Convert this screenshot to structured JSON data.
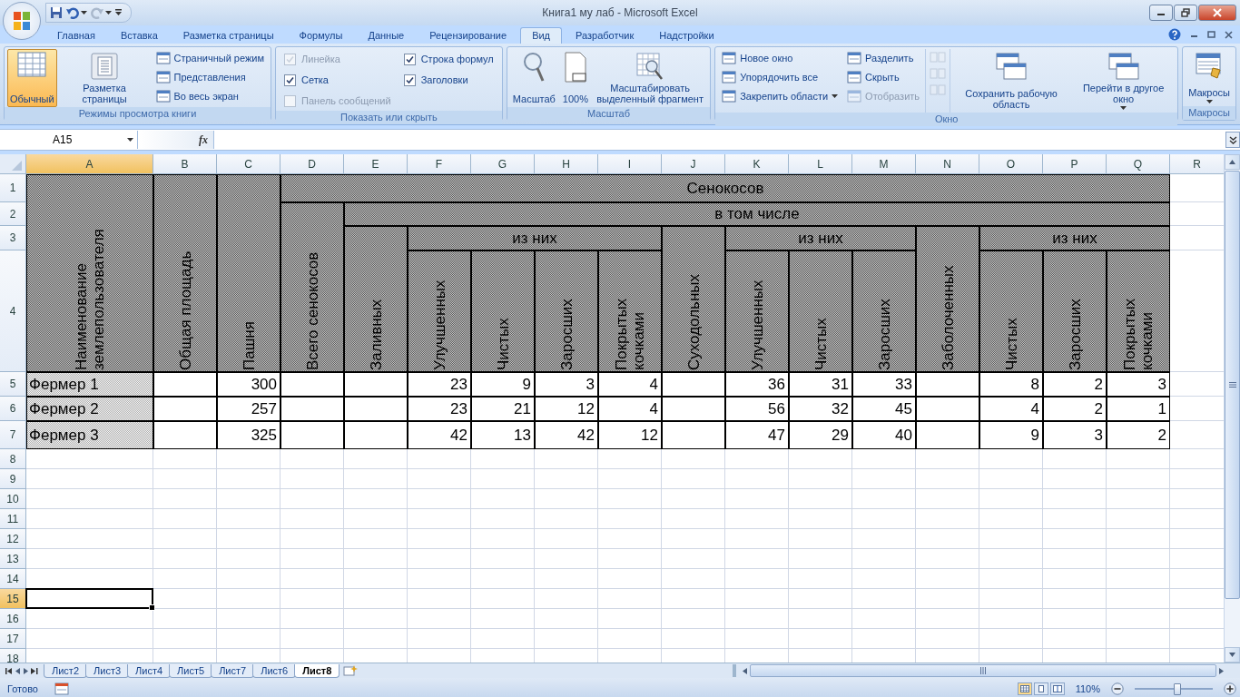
{
  "window": {
    "title": "Книга1 му лаб - Microsoft Excel"
  },
  "ribbon_tabs": [
    {
      "label": "Главная",
      "selected": false
    },
    {
      "label": "Вставка",
      "selected": false
    },
    {
      "label": "Разметка страницы",
      "selected": false
    },
    {
      "label": "Формулы",
      "selected": false
    },
    {
      "label": "Данные",
      "selected": false
    },
    {
      "label": "Рецензирование",
      "selected": false
    },
    {
      "label": "Вид",
      "selected": true
    },
    {
      "label": "Разработчик",
      "selected": false
    },
    {
      "label": "Надстройки",
      "selected": false
    }
  ],
  "ribbon_groups": [
    {
      "title": "Режимы просмотра книги",
      "items": [
        {
          "kind": "large",
          "label": "Обычный",
          "selected": true
        },
        {
          "kind": "large",
          "label": "Разметка страницы",
          "selected": false
        },
        {
          "kind": "small",
          "label": "Страничный режим",
          "selected": false
        },
        {
          "kind": "small",
          "label": "Представления",
          "selected": false
        },
        {
          "kind": "small",
          "label": "Во весь экран",
          "selected": false
        }
      ]
    },
    {
      "title": "Показать или скрыть",
      "items": [
        {
          "kind": "check",
          "label": "Линейка",
          "checked": true,
          "disabled": true
        },
        {
          "kind": "check",
          "label": "Сетка",
          "checked": true,
          "disabled": false
        },
        {
          "kind": "check",
          "label": "Панель сообщений",
          "checked": false,
          "disabled": true
        },
        {
          "kind": "check",
          "label": "Строка формул",
          "checked": true,
          "disabled": false
        },
        {
          "kind": "check",
          "label": "Заголовки",
          "checked": true,
          "disabled": false
        }
      ]
    },
    {
      "title": "Масштаб",
      "items": [
        {
          "kind": "large",
          "label": "Масштаб"
        },
        {
          "kind": "large",
          "label": "100%"
        },
        {
          "kind": "large",
          "label": "Масштабировать выделенный фрагмент"
        }
      ]
    },
    {
      "title": "Окно",
      "items": [
        {
          "kind": "small",
          "label": "Новое окно",
          "disabled": false
        },
        {
          "kind": "small",
          "label": "Упорядочить все",
          "disabled": false
        },
        {
          "kind": "small",
          "label": "Закрепить области",
          "dropdown": true,
          "disabled": false
        },
        {
          "kind": "small",
          "label": "Разделить",
          "disabled": false
        },
        {
          "kind": "small",
          "label": "Скрыть",
          "disabled": false
        },
        {
          "kind": "small",
          "label": "Отобразить",
          "disabled": true
        },
        {
          "kind": "icon",
          "disabled": true
        },
        {
          "kind": "icon",
          "disabled": true
        },
        {
          "kind": "icon",
          "disabled": true
        },
        {
          "kind": "large",
          "label": "Сохранить рабочую область"
        },
        {
          "kind": "large",
          "label": "Перейти в другое окно",
          "dropdown": true
        }
      ]
    },
    {
      "title": "Макросы",
      "items": [
        {
          "kind": "large",
          "label": "Макросы",
          "dropdown": true
        }
      ]
    }
  ],
  "formula_bar": {
    "name_box": "A15",
    "function_label": "fx"
  },
  "columns": [
    {
      "label": "A",
      "selected": true
    },
    {
      "label": "B",
      "selected": false
    },
    {
      "label": "C",
      "selected": false
    },
    {
      "label": "D",
      "selected": false
    },
    {
      "label": "E",
      "selected": false
    },
    {
      "label": "F",
      "selected": false
    },
    {
      "label": "G",
      "selected": false
    },
    {
      "label": "H",
      "selected": false
    },
    {
      "label": "I",
      "selected": false
    },
    {
      "label": "J",
      "selected": false
    },
    {
      "label": "K",
      "selected": false
    },
    {
      "label": "L",
      "selected": false
    },
    {
      "label": "M",
      "selected": false
    },
    {
      "label": "N",
      "selected": false
    },
    {
      "label": "O",
      "selected": false
    },
    {
      "label": "P",
      "selected": false
    },
    {
      "label": "Q",
      "selected": false
    },
    {
      "label": "R",
      "selected": false
    }
  ],
  "rows": [
    {
      "label": "1",
      "selected": false
    },
    {
      "label": "2",
      "selected": false
    },
    {
      "label": "3",
      "selected": false
    },
    {
      "label": "4",
      "selected": false
    },
    {
      "label": "5",
      "selected": false
    },
    {
      "label": "6",
      "selected": false
    },
    {
      "label": "7",
      "selected": false
    },
    {
      "label": "8",
      "selected": false
    },
    {
      "label": "9",
      "selected": false
    },
    {
      "label": "10",
      "selected": false
    },
    {
      "label": "11",
      "selected": false
    },
    {
      "label": "12",
      "selected": false
    },
    {
      "label": "13",
      "selected": false
    },
    {
      "label": "14",
      "selected": false
    },
    {
      "label": "15",
      "selected": true
    },
    {
      "label": "16",
      "selected": false
    },
    {
      "label": "17",
      "selected": false
    },
    {
      "label": "18",
      "selected": false
    }
  ],
  "table": {
    "header": {
      "name_column": "Наименование землепользователя",
      "total_area": "Общая площадь",
      "arable": "Пашня",
      "hayfields": "Сенокосов",
      "hayfields_total": "Всего сенокосов",
      "including": "в том числе",
      "groups": [
        {
          "label": "Заливных",
          "sub_label": "из них",
          "subs": [
            "Улучшенных",
            "Чистых",
            "Заросших",
            "Покрытых кочками"
          ]
        },
        {
          "label": "Суходольных",
          "sub_label": "из них",
          "subs": [
            "Улучшенных",
            "Чистых",
            "Заросших"
          ]
        },
        {
          "label": "Заболоченных",
          "sub_label": "из них",
          "subs": [
            "Чистых",
            "Заросших",
            "Покрытых кочками"
          ]
        }
      ]
    },
    "rows": [
      {
        "name": "Фермер 1",
        "arable": "300",
        "groups": [
          [
            "23",
            "9",
            "3",
            "4"
          ],
          [
            "36",
            "31",
            "33"
          ],
          [
            "8",
            "2",
            "3"
          ]
        ]
      },
      {
        "name": "Фермер 2",
        "arable": "257",
        "groups": [
          [
            "23",
            "21",
            "12",
            "4"
          ],
          [
            "56",
            "32",
            "45"
          ],
          [
            "4",
            "2",
            "1"
          ]
        ]
      },
      {
        "name": "Фермер 3",
        "arable": "325",
        "groups": [
          [
            "42",
            "13",
            "42",
            "12"
          ],
          [
            "47",
            "29",
            "40"
          ],
          [
            "9",
            "3",
            "2"
          ]
        ]
      }
    ]
  },
  "sheet_tabs": [
    {
      "label": "Лист2",
      "selected": false
    },
    {
      "label": "Лист3",
      "selected": false
    },
    {
      "label": "Лист4",
      "selected": false
    },
    {
      "label": "Лист5",
      "selected": false
    },
    {
      "label": "Лист7",
      "selected": false
    },
    {
      "label": "Лист6",
      "selected": false
    },
    {
      "label": "Лист8",
      "selected": true
    }
  ],
  "status_bar": {
    "status": "Готово",
    "zoom": "110%",
    "zoom_slider": {
      "level": 0.55
    }
  }
}
